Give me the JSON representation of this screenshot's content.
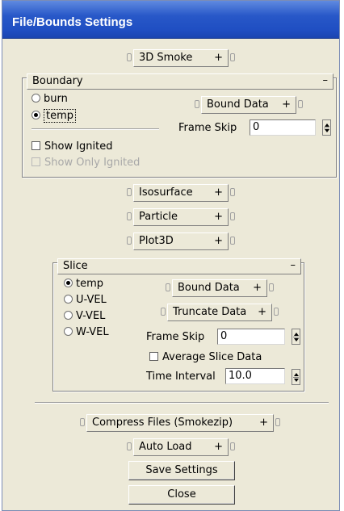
{
  "window": {
    "title": "File/Bounds Settings"
  },
  "rollouts": {
    "smoke3d": "3D Smoke",
    "isosurface": "Isosurface",
    "particle": "Particle",
    "plot3d": "Plot3D",
    "compress": "Compress Files (Smokezip)",
    "autoload": "Auto Load"
  },
  "boundary": {
    "title": "Boundary",
    "minimize": "–",
    "options": [
      "burn",
      "temp"
    ],
    "selected": "temp",
    "bound_data": "Bound Data",
    "frame_skip_label": "Frame Skip",
    "frame_skip_value": "0",
    "show_ignited": "Show Ignited",
    "show_only_ignited": "Show Only Ignited"
  },
  "slice": {
    "title": "Slice",
    "minimize": "–",
    "options": [
      "temp",
      "U-VEL",
      "V-VEL",
      "W-VEL"
    ],
    "selected": "temp",
    "bound_data": "Bound Data",
    "truncate_data": "Truncate Data",
    "frame_skip_label": "Frame Skip",
    "frame_skip_value": "0",
    "average_slice": "Average Slice Data",
    "time_interval_label": "Time Interval",
    "time_interval_value": "10.0"
  },
  "plus": "+",
  "buttons": {
    "save": "Save Settings",
    "close": "Close"
  }
}
